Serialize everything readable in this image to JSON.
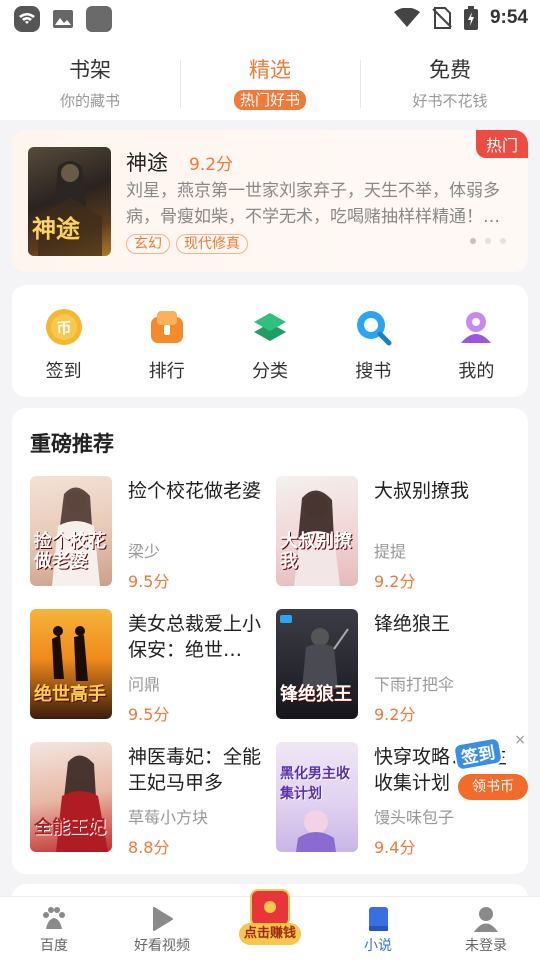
{
  "status_bar": {
    "time": "9:54",
    "left_icons": [
      "wifi-app-icon",
      "image-icon",
      "app-icon"
    ],
    "right_icons": [
      "wifi-icon",
      "no-sim-icon",
      "battery-charging-icon"
    ]
  },
  "top_tabs": [
    {
      "title": "书架",
      "subtitle": "你的藏书",
      "active": false
    },
    {
      "title": "精选",
      "subtitle": "热门好书",
      "active": true
    },
    {
      "title": "免费",
      "subtitle": "好书不花钱",
      "active": false
    }
  ],
  "hot_banner": {
    "tag": "热门",
    "cover_text": "神途",
    "title": "神途",
    "score": "9.2分",
    "description": "刘星，燕京第一世家刘家弃子，天生不举，体弱多病，骨瘦如柴，不学无术，吃喝赌抽样样精通！…",
    "tags": [
      "玄幻",
      "现代修真"
    ],
    "carousel_index": 1,
    "carousel_count": 3
  },
  "quick_menu": [
    {
      "label": "签到",
      "icon": "coin-icon",
      "color": "#f5b731"
    },
    {
      "label": "排行",
      "icon": "rank-icon",
      "color": "#f58a2a"
    },
    {
      "label": "分类",
      "icon": "layers-icon",
      "color": "#2fbf7e"
    },
    {
      "label": "搜书",
      "icon": "search-icon",
      "color": "#2aa6f0"
    },
    {
      "label": "我的",
      "icon": "user-icon",
      "color": "#b36be8"
    }
  ],
  "recommend": {
    "title": "重磅推荐",
    "books": [
      {
        "title": "捡个校花做老婆",
        "author": "梁少",
        "score": "9.5分",
        "cover_text": "捡个校花做老婆",
        "cover_colors": [
          "#f3e2d6",
          "#c9a08a"
        ]
      },
      {
        "title": "大叔别撩我",
        "author": "提提",
        "score": "9.2分",
        "cover_text": "大叔别撩我",
        "cover_colors": [
          "#f4f0ee",
          "#e7b9b9"
        ]
      },
      {
        "title": "美女总裁爱上小保安：绝世…",
        "author": "问鼎",
        "score": "9.5分",
        "cover_text": "绝世高手",
        "cover_colors": [
          "#f08a1c",
          "#3a1c0c"
        ]
      },
      {
        "title": "锋绝狼王",
        "author": "下雨打把伞",
        "score": "9.2分",
        "cover_text": "锋绝狼王",
        "cover_colors": [
          "#3c3c46",
          "#15151a"
        ]
      },
      {
        "title": "神医毒妃：全能王妃马甲多",
        "author": "草莓小方块",
        "score": "8.8分",
        "cover_text": "全能王妃",
        "cover_colors": [
          "#f4e6df",
          "#c22c2c"
        ]
      },
      {
        "title": "快穿攻略：男主收集计划",
        "author": "馒头味包子",
        "score": "9.4分",
        "cover_text": "黑化男主收集计划",
        "cover_colors": [
          "#efe6f4",
          "#c8b6e8"
        ]
      }
    ]
  },
  "floating_badge": {
    "sign_text": "签到",
    "coin_text": "领书币",
    "close": "×"
  },
  "bottom_nav": [
    {
      "label": "百度",
      "icon": "baidu-paw-icon",
      "active": false
    },
    {
      "label": "好看视频",
      "icon": "video-play-icon",
      "active": false
    },
    {
      "label": "点击赚钱",
      "icon": "red-envelope-icon",
      "active": false
    },
    {
      "label": "小说",
      "icon": "book-icon",
      "active": true
    },
    {
      "label": "未登录",
      "icon": "user-avatar-icon",
      "active": false
    }
  ]
}
